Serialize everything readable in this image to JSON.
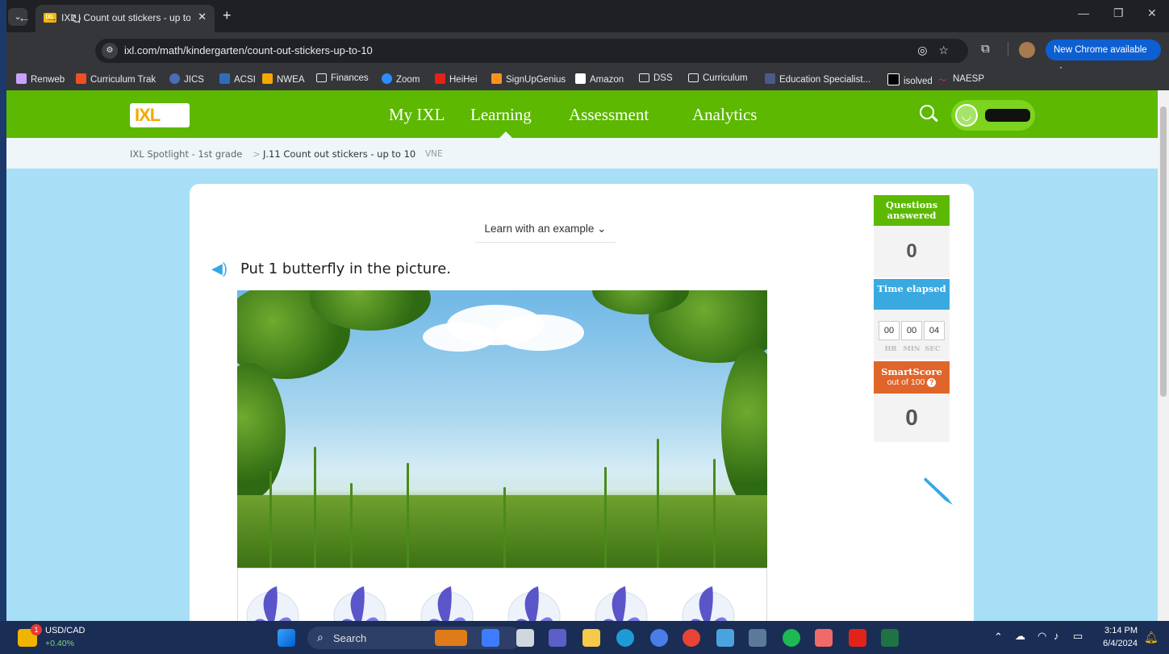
{
  "browser": {
    "tab_title": "IXL | Count out stickers - up to",
    "tab_favicon": "IXL",
    "url": "ixl.com/math/kindergarten/count-out-stickers-up-to-10",
    "new_chrome": "New Chrome available",
    "bookmarks": [
      "Renweb",
      "Curriculum Trak",
      "JICS",
      "ACSI",
      "NWEA",
      "Finances",
      "Zoom",
      "HeiHei",
      "SignUpGenius",
      "Amazon",
      "DSS",
      "Curriculum",
      "Education Specialist...",
      "isolved",
      "NAESP"
    ]
  },
  "ixl": {
    "logo": "IXL",
    "nav": [
      "My IXL",
      "Learning",
      "Assessment",
      "Analytics"
    ],
    "active_nav": "Learning",
    "breadcrumb": {
      "parent": "IXL Spotlight - 1st grade",
      "separator": ">",
      "current": "J.11 Count out stickers - up to 10",
      "code": "VNE"
    }
  },
  "practice": {
    "learn_link": "Learn with an example",
    "question": "Put 1 butterfly in the picture.",
    "sticker_count_visible": 6
  },
  "stats": {
    "questions_label": "Questions answered",
    "questions_value": "0",
    "time_label": "Time elapsed",
    "time": {
      "hr": "00",
      "min": "00",
      "sec": "04"
    },
    "time_units": {
      "hr": "HR",
      "min": "MIN",
      "sec": "SEC"
    },
    "smartscore_label": "SmartScore",
    "smartscore_sub": "out of 100",
    "smartscore_value": "0"
  },
  "taskbar": {
    "ticker": "USD/CAD",
    "ticker_change": "+0.40%",
    "ticker_badge": "1",
    "search_placeholder": "Search",
    "time": "3:14 PM",
    "date": "6/4/2024"
  },
  "colors": {
    "ixl_green": "#5cb800",
    "page_blue": "#a8dff6",
    "time_blue": "#3aa9e0",
    "smartscore_orange": "#e0652a"
  }
}
